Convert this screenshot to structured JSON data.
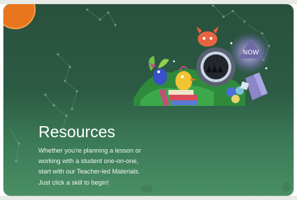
{
  "card": {
    "title": "Resources",
    "description_lines": [
      "Whether you're planning a lesson or",
      "working with a student one-on-one,",
      "start with our Teacher-led Materials.",
      "Just click a skill to begin!"
    ],
    "colors": {
      "background_top": "#29503d",
      "background_bottom": "#4a8f63",
      "badge": "#e8761e"
    }
  },
  "illustration": {
    "sign_text": "NOW"
  }
}
